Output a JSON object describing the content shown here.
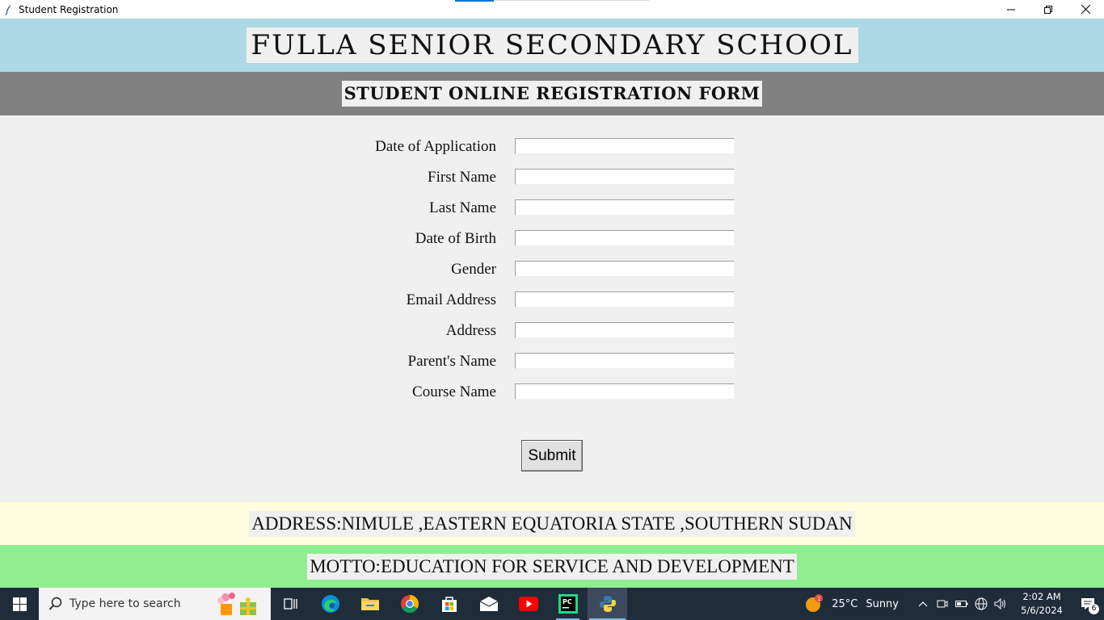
{
  "window": {
    "title": "Student Registration"
  },
  "header": {
    "school_name": "FULLA SENIOR SECONDARY SCHOOL",
    "form_title": "STUDENT ONLINE REGISTRATION FORM"
  },
  "form": {
    "fields": [
      {
        "label": "Date of Application",
        "value": ""
      },
      {
        "label": "First Name",
        "value": ""
      },
      {
        "label": "Last Name",
        "value": ""
      },
      {
        "label": "Date of Birth",
        "value": ""
      },
      {
        "label": "Gender",
        "value": ""
      },
      {
        "label": "Email Address",
        "value": ""
      },
      {
        "label": "Address",
        "value": ""
      },
      {
        "label": "Parent's Name",
        "value": ""
      },
      {
        "label": "Course Name",
        "value": ""
      }
    ],
    "submit_label": "Submit"
  },
  "footer": {
    "address": "ADDRESS:NIMULE ,EASTERN EQUATORIA STATE ,SOUTHERN SUDAN",
    "motto": "MOTTO:EDUCATION FOR SERVICE AND DEVELOPMENT"
  },
  "taskbar": {
    "search_placeholder": "Type here to search",
    "weather_temp": "25°C",
    "weather_condition": "Sunny",
    "weather_badge": "1",
    "time": "2:02 AM",
    "date": "5/6/2024",
    "notification_count": "6",
    "pinned_apps": [
      "task-view",
      "edge",
      "file-explorer",
      "chrome",
      "microsoft-store",
      "mail",
      "youtube",
      "pycharm",
      "python"
    ]
  },
  "colors": {
    "school_band": "#add8e6",
    "form_band": "#808080",
    "address_band": "#ffffe0",
    "motto_band": "#90ee90",
    "window_bg": "#f0f0f0",
    "taskbar": "#1f2c3a"
  }
}
